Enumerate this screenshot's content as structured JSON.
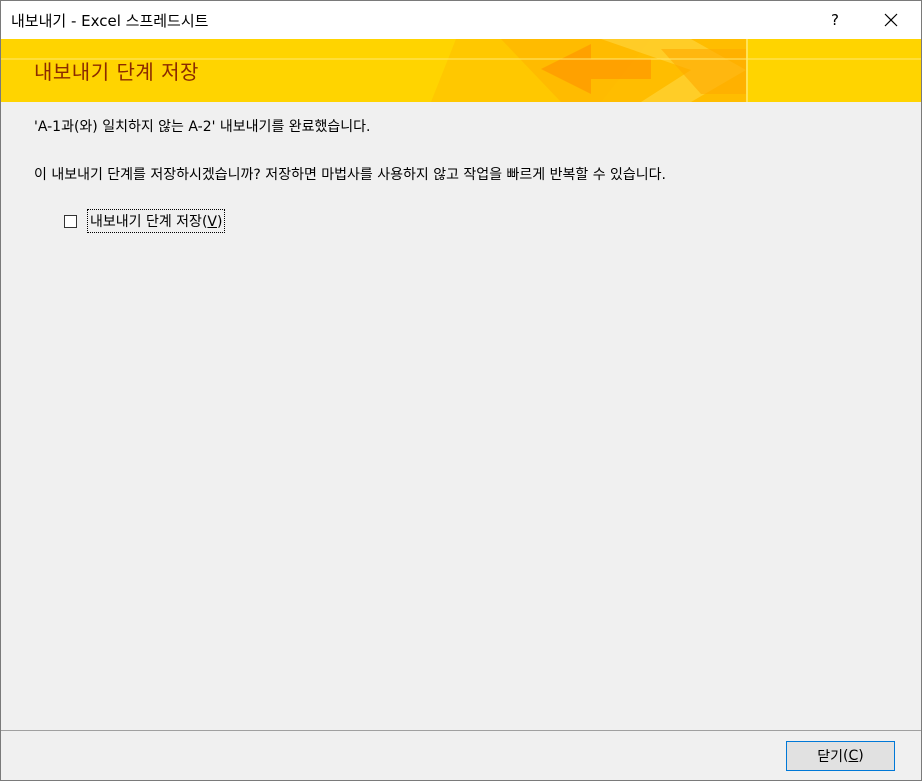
{
  "window": {
    "title": "내보내기 - Excel 스프레드시트",
    "help_glyph": "?"
  },
  "banner": {
    "title": "내보내기 단계 저장"
  },
  "content": {
    "completed_message": "'A-1과(와) 일치하지 않는 A-2' 내보내기를 완료했습니다.",
    "save_question": "이 내보내기 단계를 저장하시겠습니까? 저장하면 마법사를 사용하지 않고 작업을 빠르게 반복할 수 있습니다.",
    "save_checkbox": {
      "label": "내보내기 단계 저장",
      "accel_open": "(",
      "accel_key": "V",
      "accel_close": ")",
      "checked": false
    }
  },
  "footer": {
    "close_label": "닫기",
    "accel_open": "(",
    "accel_key": "C",
    "accel_close": ")"
  },
  "colors": {
    "banner_yellow": "#ffd400",
    "banner_orange": "#f5a300",
    "banner_title": "#8b2a00",
    "focus_border": "#0078d7"
  },
  "icons": {
    "help": "question-mark",
    "close": "x-glyph"
  }
}
